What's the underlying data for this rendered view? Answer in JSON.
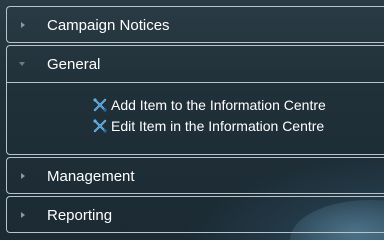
{
  "panels": [
    {
      "label": "Campaign Notices",
      "expanded": false
    },
    {
      "label": "General",
      "expanded": true,
      "items": [
        {
          "label": "Add Item to the Information Centre",
          "icon": "tools-x-icon"
        },
        {
          "label": "Edit Item in the Information Centre",
          "icon": "tools-x-icon"
        }
      ]
    },
    {
      "label": "Management",
      "expanded": false
    },
    {
      "label": "Reporting",
      "expanded": false
    }
  ],
  "colors": {
    "background": "#203039",
    "border": "#b9c3c9",
    "text": "#ffffff",
    "icon_blue": "#2f8fd8"
  }
}
